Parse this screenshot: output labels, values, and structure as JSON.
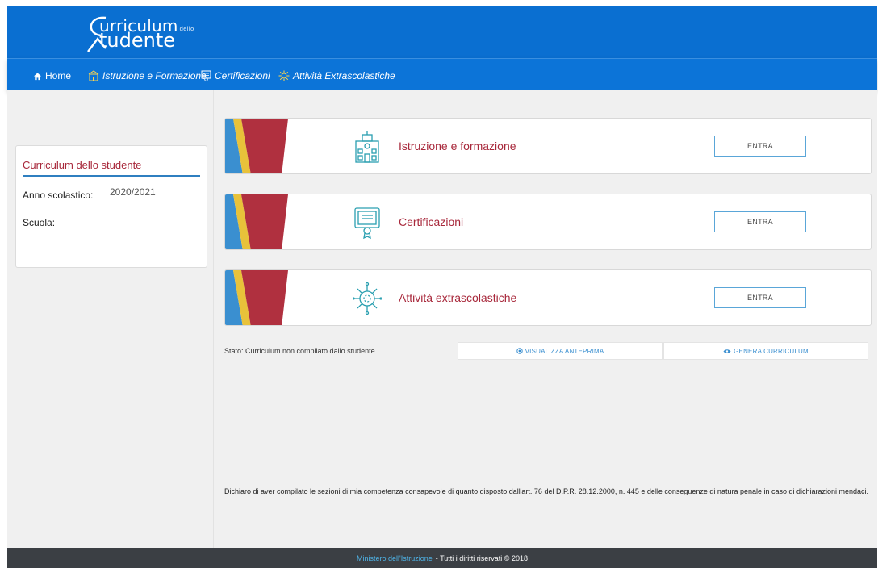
{
  "brand": {
    "title_line1": "urriculum",
    "title_small": "dello",
    "title_line2": "tudente"
  },
  "nav": {
    "items": [
      {
        "label": "Home",
        "icon": "home-icon"
      },
      {
        "label": "Istruzione e Formazione",
        "icon": "school-building-icon"
      },
      {
        "label": "Certificazioni",
        "icon": "certificate-icon"
      },
      {
        "label": "Attività Extrascolastiche",
        "icon": "star-burst-icon"
      }
    ]
  },
  "sidebar": {
    "title": "Curriculum dello studente",
    "year_label": "Anno scolastico:",
    "year_value": "2020/2021",
    "school_label": "Scuola:"
  },
  "sections": [
    {
      "title": "Istruzione e formazione",
      "button": "ENTRA",
      "icon": "school-building-icon"
    },
    {
      "title": "Certificazioni",
      "button": "ENTRA",
      "icon": "certificate-icon"
    },
    {
      "title": "Attività extrascolastiche",
      "button": "ENTRA",
      "icon": "virus-icon"
    }
  ],
  "status": {
    "text": "Stato: Curriculum non compilato dallo studente",
    "preview_label": "VISUALIZZA ANTEPRIMA",
    "generate_label": "GENERA CURRICULUM"
  },
  "declaration": "Dichiaro di aver compilato le sezioni di mia competenza consapevole di quanto disposto dall'art. 76 del D.P.R. 28.12.2000, n. 445 e delle conseguenze di natura penale in caso di dichiarazioni mendaci.",
  "footer": {
    "link": "Ministero dell'Istruzione",
    "rest": "- Tutti i diritti riservati © 2018"
  },
  "colors": {
    "brand_blue": "#0a6fd1",
    "accent_red": "#a8283b",
    "icon_teal": "#2a9fb0",
    "footer_bg": "#3b3f44"
  }
}
